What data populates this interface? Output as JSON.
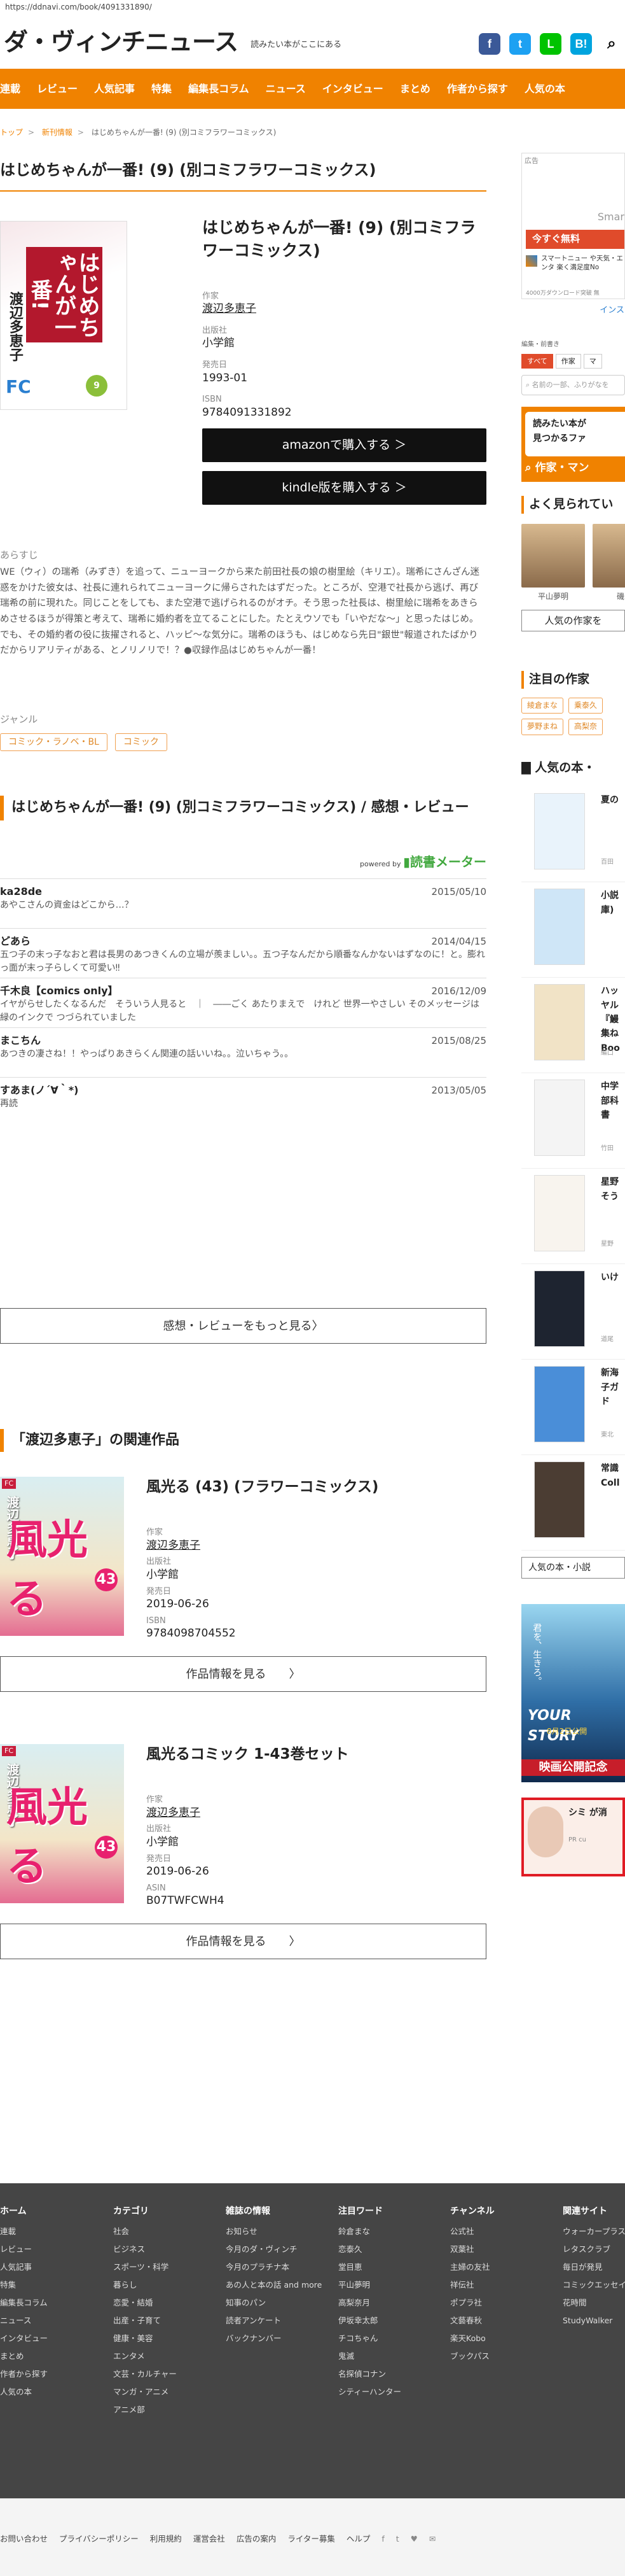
{
  "browser": {
    "url": "https://ddnavi.com/book/4091331890/"
  },
  "site": {
    "logo": "ダ・ヴィンチニュース",
    "tagline": "読みたい本がここにある"
  },
  "social": [
    {
      "name": "facebook-icon",
      "glyph": "f",
      "color": "#3b5998"
    },
    {
      "name": "twitter-icon",
      "glyph": "t",
      "color": "#1da1f2"
    },
    {
      "name": "line-icon",
      "glyph": "L",
      "color": "#00c300"
    },
    {
      "name": "hatena-icon",
      "glyph": "B!",
      "color": "#00a4de"
    },
    {
      "name": "search-icon",
      "glyph": "⌕",
      "color": "#fff"
    }
  ],
  "nav": [
    "連載",
    "レビュー",
    "人気記事",
    "特集",
    "編集長コラム",
    "ニュース",
    "インタビュー",
    "まとめ",
    "作者から探す",
    "人気の本"
  ],
  "breadcrumb": {
    "home": "トップ",
    "section": "新刊情報",
    "current": "はじめちゃんが一番! (9) (別コミフラワーコミックス)"
  },
  "book": {
    "page_title": "はじめちゃんが一番! (9) (別コミフラワーコミックス)",
    "title": "はじめちゃんが一番! (9) (別コミフラワーコミックス)",
    "author_label": "作家",
    "author": "渡辺多恵子",
    "publisher_label": "出版社",
    "publisher": "小学館",
    "date_label": "発売日",
    "date": "1993-01",
    "isbn_label": "ISBN",
    "isbn": "9784091331892",
    "amazon_btn": "amazonで購入する ＞",
    "kindle_btn": "kindle版を購入する ＞",
    "cover_text": {
      "title": "はじめちゃんが一番!",
      "author": "渡辺多恵子",
      "label": "FC",
      "vol": "9"
    },
    "synopsis_label": "あらすじ",
    "synopsis": "WE（ウィ）の瑞希（みずき）を追って、ニューヨークから来た前田社長の娘の樹里絵（キリエ）。瑞希にさんざん迷惑をかけた彼女は、社長に連れられてニューヨークに帰らされたはずだった。ところが、空港で社長から逃げ、再び瑞希の前に現れた。同じことをしても、また空港で逃げられるのがオチ。そう思った社長は、樹里絵に瑞希をあきらめさせるほうが得策と考えて、瑞希に婚約者を立てることにした。たとえウソでも「いやだな〜」と思ったはじめ。でも、その婚約者の役に抜擢されると、ハッピ〜な気分に。瑞希のほうも、はじめなら先日\"銀世\"報道されたばかりだからリアリティがある、とノリノリで！？●収録作品はじめちゃんが一番！",
    "genre_label": "ジャンル",
    "genres": [
      "コミック・ラノベ・BL",
      "コミック"
    ]
  },
  "reviews": {
    "heading": "はじめちゃんが一番! (9) (別コミフラワーコミックス) / 感想・レビュー",
    "powered_by": "powered by",
    "powered_brand": "読書メーター",
    "items": [
      {
        "name": "ka28de",
        "date": "2015/05/10",
        "text": "あやこさんの資金はどこから…？"
      },
      {
        "name": "どあら",
        "date": "2014/04/15",
        "text": "五つ子の末っ子なおと君は長男のあつきくんの立場が羨ましい。。五つ子なんだから順番なんかないはずなのに！と。膨れっ面が末っ子らしくて可愛い‼︎"
      },
      {
        "name": "千木良【comics only】",
        "date": "2016/12/09",
        "text": "イヤがらせしたくなるんだ　そういう人見ると　｜　――ごく あたりまえで　けれど 世界一やさしい そのメッセージは　緑のインクで つづられていました"
      },
      {
        "name": "まこちん",
        "date": "2015/08/25",
        "text": "あつきの凄さね！！やっぱりあきらくん関連の話いいね。。泣いちゃう。。"
      },
      {
        "name": "すあま(ノ´∀｀*)",
        "date": "2013/05/05",
        "text": "再読"
      }
    ],
    "more_btn": "感想・レビューをもっと見る〉"
  },
  "related": {
    "heading": "「渡辺多恵子」の関連作品",
    "items": [
      {
        "title": "風光る (43) (フラワーコミックス)",
        "author_label": "作家",
        "author": "渡辺多恵子",
        "publisher_label": "出版社",
        "publisher": "小学館",
        "date_label": "発売日",
        "date": "2019-06-26",
        "code_label": "ISBN",
        "code": "9784098704552",
        "btn": "作品情報を見る　　〉",
        "cover_logo": "風光る",
        "cover_vol": "43",
        "cover_label": "FC",
        "cover_author": "渡辺多恵子"
      },
      {
        "title": "風光るコミック 1-43巻セット",
        "author_label": "作家",
        "author": "渡辺多恵子",
        "publisher_label": "出版社",
        "publisher": "小学館",
        "date_label": "発売日",
        "date": "2019-06-26",
        "code_label": "ASIN",
        "code": "B07TWFCWH4",
        "btn": "作品情報を見る　　〉",
        "cover_logo": "風光る",
        "cover_vol": "43",
        "cover_label": "FC",
        "cover_author": "渡辺多恵子"
      }
    ]
  },
  "sidebar": {
    "ad_label": "広告",
    "ad_smart": "Smar",
    "ad_free_btn": "今すぐ無料",
    "ad_app_text": "スマートニュー や天気・エンタ 楽く満足度No",
    "ad_downloads": "4000万ダウンロード突破 無",
    "ad_install": "インス",
    "filter_label": "編集・前書き",
    "filter_tabs": [
      "すべて",
      "作家",
      "マ"
    ],
    "search_placeholder": "名前の一部、ふりがなを",
    "banner_line1": "読みたい本が",
    "banner_line2": "見つかるファ",
    "banner_line3": "作家・マン",
    "popular_heading": "よく見られてい",
    "people": [
      "平山夢明",
      "磯田"
    ],
    "people_more": "人気の作家を",
    "featured_heading": "注目の作家",
    "featured_tags": [
      "綾倉まな",
      "乗泰久",
      "夢野まね",
      "高梨奈"
    ],
    "rank_heading": "人気の本・",
    "ranks": [
      {
        "title": "夏の",
        "sub": "百田"
      },
      {
        "title": "小説 庫)",
        "sub": ""
      },
      {
        "title": "ハッ ヤル 『鰻 集ね Boo",
        "sub": "編口"
      },
      {
        "title": "中学 部科 書",
        "sub": "竹田"
      },
      {
        "title": "星野 そう",
        "sub": "星野"
      },
      {
        "title": "いけ",
        "sub": "道尾"
      },
      {
        "title": "新海 子ガ ド",
        "sub": "東北"
      },
      {
        "title": "常識 Coll",
        "sub": ""
      }
    ],
    "rank_more": "人気の本・小説",
    "ad2_text1": "君を、生きろ。",
    "ad2_text2": "YOUR STORY",
    "ad2_text3": "8月2日公開",
    "ad2_text4": "映画公開記念",
    "ad3_text": "シミ が消",
    "ad3_brand": "PR cu"
  },
  "footer": {
    "cols": [
      {
        "head": "ホーム",
        "items": [
          "連載",
          "レビュー",
          "人気記事",
          "特集",
          "編集長コラム",
          "ニュース",
          "インタビュー",
          "まとめ",
          "作者から探す",
          "人気の本"
        ]
      },
      {
        "head": "カテゴリ",
        "items": [
          "社会",
          "ビジネス",
          "スポーツ・科学",
          "暮らし",
          "恋愛・結婚",
          "出産・子育て",
          "健康・美容",
          "エンタメ",
          "文芸・カルチャー",
          "マンガ・アニメ",
          "アニメ部"
        ]
      },
      {
        "head": "雑誌の情報",
        "items": [
          "お知らせ",
          "今月のダ・ヴィンチ",
          "今月のプラチナ本",
          "あの人と本の話 and more",
          "知事のパン",
          "読者アンケート",
          "バックナンバー"
        ]
      },
      {
        "head": "注目ワード",
        "items": [
          "鈴倉まな",
          "恋泰久",
          "堂目恵",
          "平山夢明",
          "高梨奈月",
          "伊坂幸太郎",
          "チコちゃん",
          "鬼滅",
          "名探偵コナン",
          "シティーハンター"
        ]
      },
      {
        "head": "チャンネル",
        "items": [
          "公式社",
          "双葉社",
          "主婦の友社",
          "祥伝社",
          "ポプラ社",
          "文藝春秋",
          "楽天Kobo",
          "ブックパス"
        ]
      },
      {
        "head": "関連サイト",
        "items": [
          "ウォーカープラス",
          "レタスクラブ",
          "毎日が発見",
          "コミックエッセイ",
          "花時間",
          "StudyWalker"
        ]
      }
    ],
    "bottom": [
      "お問い合わせ",
      "プライバシーポリシー",
      "利用規約",
      "運営会社",
      "広告の案内",
      "ライター募集",
      "ヘルプ"
    ],
    "bottom_icons": [
      "f",
      "t",
      "♥",
      "✉"
    ]
  }
}
